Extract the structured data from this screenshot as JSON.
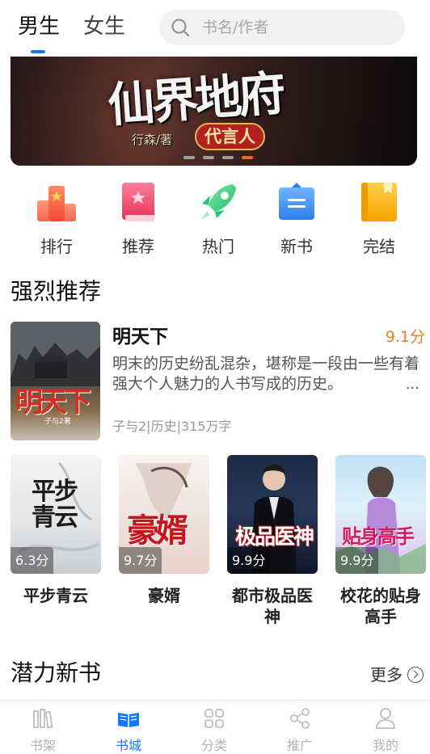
{
  "header": {
    "tabs": [
      {
        "label": "男生",
        "active": true
      },
      {
        "label": "女生",
        "active": false
      }
    ],
    "search": {
      "placeholder": "书名/作者",
      "icon": "search-icon"
    }
  },
  "banner": {
    "title": "仙界地府",
    "author": "行森/著",
    "tag": "代言人",
    "dots": 4,
    "active_dot": 4,
    "accent": "#f26a1b"
  },
  "categories": [
    {
      "label": "排行",
      "icon": "ranking-icon"
    },
    {
      "label": "推荐",
      "icon": "recommend-icon"
    },
    {
      "label": "热门",
      "icon": "rocket-icon"
    },
    {
      "label": "新书",
      "icon": "new-book-icon"
    },
    {
      "label": "完结",
      "icon": "finished-icon"
    }
  ],
  "recommend": {
    "section_title": "强烈推荐",
    "featured": {
      "title": "明天下",
      "score": "9.1分",
      "description": "明末的历史纷乱混杂，堪称是一段由一些有着强大个人魅力的人书写成的历史。",
      "more": "...",
      "meta": "子与2|历史|315万字",
      "cover_title": "明天下",
      "cover_author": "子与2著"
    },
    "books": [
      {
        "name": "平步青云",
        "score": "6.3分",
        "cover_title": "平步青云"
      },
      {
        "name": "豪婿",
        "score": "9.7分",
        "cover_title": "豪婿"
      },
      {
        "name": "都市极品医神",
        "score": "9.9分",
        "cover_title": "极品医神"
      },
      {
        "name": "校花的贴身高手",
        "score": "9.9分",
        "cover_title": "贴身高手"
      }
    ]
  },
  "new_books": {
    "section_title": "潜力新书",
    "more_label": "更多"
  },
  "bottom_nav": [
    {
      "label": "书架",
      "icon": "bookshelf-icon",
      "active": false
    },
    {
      "label": "书城",
      "icon": "book-city-icon",
      "active": true
    },
    {
      "label": "分类",
      "icon": "category-icon",
      "active": false
    },
    {
      "label": "推广",
      "icon": "share-icon",
      "active": false
    },
    {
      "label": "我的",
      "icon": "user-icon",
      "active": false
    }
  ],
  "colors": {
    "accent": "#1677ff",
    "score": "#e6821e"
  }
}
